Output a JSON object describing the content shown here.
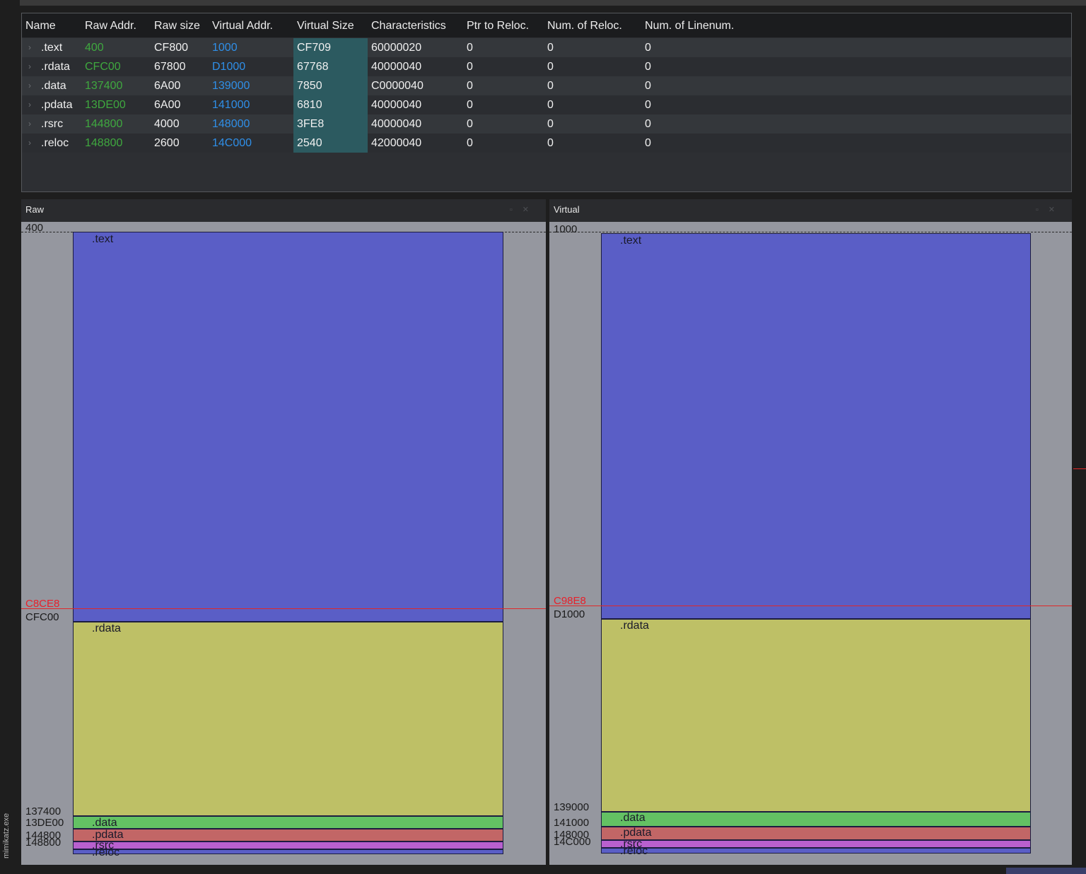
{
  "file_tab": "mimikatz.exe",
  "table": {
    "columns": [
      "Name",
      "Raw Addr.",
      "Raw size",
      "Virtual Addr.",
      "Virtual Size",
      "Characteristics",
      "Ptr to Reloc.",
      "Num. of Reloc.",
      "Num. of Linenum."
    ],
    "rows": [
      {
        "name": ".text",
        "raw_addr": "400",
        "raw_size": "CF800",
        "virtual_addr": "1000",
        "virtual_size": "CF709",
        "characteristics": "60000020",
        "ptr_reloc": "0",
        "num_reloc": "0",
        "num_linenum": "0"
      },
      {
        "name": ".rdata",
        "raw_addr": "CFC00",
        "raw_size": "67800",
        "virtual_addr": "D1000",
        "virtual_size": "67768",
        "characteristics": "40000040",
        "ptr_reloc": "0",
        "num_reloc": "0",
        "num_linenum": "0"
      },
      {
        "name": ".data",
        "raw_addr": "137400",
        "raw_size": "6A00",
        "virtual_addr": "139000",
        "virtual_size": "7850",
        "characteristics": "C0000040",
        "ptr_reloc": "0",
        "num_reloc": "0",
        "num_linenum": "0"
      },
      {
        "name": ".pdata",
        "raw_addr": "13DE00",
        "raw_size": "6A00",
        "virtual_addr": "141000",
        "virtual_size": "6810",
        "characteristics": "40000040",
        "ptr_reloc": "0",
        "num_reloc": "0",
        "num_linenum": "0"
      },
      {
        "name": ".rsrc",
        "raw_addr": "144800",
        "raw_size": "4000",
        "virtual_addr": "148000",
        "virtual_size": "3FE8",
        "characteristics": "40000040",
        "ptr_reloc": "0",
        "num_reloc": "0",
        "num_linenum": "0"
      },
      {
        "name": ".reloc",
        "raw_addr": "148800",
        "raw_size": "2600",
        "virtual_addr": "14C000",
        "virtual_size": "2540",
        "characteristics": "42000040",
        "ptr_reloc": "0",
        "num_reloc": "0",
        "num_linenum": "0"
      }
    ]
  },
  "raw_panel": {
    "title": "Raw",
    "start_label": "400",
    "marker_label": "C8CE8",
    "addr_labels": [
      "CFC00",
      "137400",
      "13DE00",
      "144800",
      "148800"
    ],
    "blocks": [
      ".text",
      ".rdata",
      ".data",
      ".pdata",
      ".rsrc",
      ".reloc"
    ]
  },
  "virtual_panel": {
    "title": "Virtual",
    "start_label": "1000",
    "marker_label": "C98E8",
    "addr_labels": [
      "D1000",
      "139000",
      "141000",
      "148000",
      "14C000"
    ],
    "blocks": [
      ".text",
      ".rdata",
      ".data",
      ".pdata",
      ".rsrc",
      ".reloc"
    ]
  },
  "colors": {
    "text_block": "#5a5ec6",
    "rdata_block": "#bec066",
    "data_block": "#63c163",
    "pdata_block": "#c26666",
    "rsrc_block": "#b860cf",
    "reloc_block": "#5a5ec6",
    "raw_addr_green": "#3fa83f",
    "virt_addr_blue": "#2f8fe8",
    "marker_red": "#e02828"
  },
  "icons": {
    "row_expander": "chevron-right-icon",
    "panel_buttons": [
      "pin-icon",
      "close-icon"
    ]
  }
}
